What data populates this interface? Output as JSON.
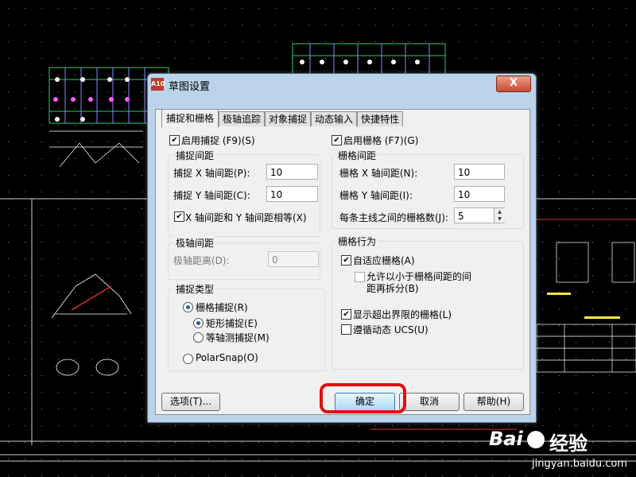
{
  "dialog": {
    "title": "草图设置",
    "app_icon": "A10",
    "close_label": "X",
    "tabs": [
      "捕捉和栅格",
      "极轴追踪",
      "对象捕捉",
      "动态输入",
      "快捷特性"
    ],
    "active_tab": 0
  },
  "snap": {
    "enable_label": "启用捕捉 (F9)(S)",
    "enabled": true,
    "spacing_group": "捕捉间距",
    "x_label": "捕捉 X 轴间距(P):",
    "x_value": "10",
    "y_label": "捕捉 Y 轴间距(C):",
    "y_value": "10",
    "equal_label": "X 轴间距和 Y 轴间距相等(X)",
    "equal_checked": true
  },
  "polar": {
    "group": "极轴间距",
    "distance_label": "极轴距离(D):",
    "distance_value": "0"
  },
  "snap_type": {
    "group": "捕捉类型",
    "grid_snap_label": "栅格捕捉(R)",
    "rect_label": "矩形捕捉(E)",
    "iso_label": "等轴测捕捉(M)",
    "polar_label": "PolarSnap(O)"
  },
  "grid": {
    "enable_label": "启用栅格 (F7)(G)",
    "enabled": true,
    "spacing_group": "栅格间距",
    "x_label": "栅格 X 轴间距(N):",
    "x_value": "10",
    "y_label": "栅格 Y 轴间距(I):",
    "y_value": "10",
    "major_label": "每条主线之间的栅格数(J):",
    "major_value": "5"
  },
  "grid_behavior": {
    "group": "栅格行为",
    "adaptive_label": "自适应栅格(A)",
    "adaptive_checked": true,
    "subdivide_label_1": "允许以小于栅格间距的间",
    "subdivide_label_2": "距再拆分(B)",
    "subdivide_checked": false,
    "beyond_label": "显示超出界限的栅格(L)",
    "beyond_checked": true,
    "dynamic_ucs_label": "遵循动态 UCS(U)",
    "dynamic_ucs_checked": false
  },
  "buttons": {
    "options": "选项(T)...",
    "ok": "确定",
    "cancel": "取消",
    "help": "帮助(H)"
  },
  "watermark": {
    "brand_a": "Bai",
    "brand_b": "经验",
    "url": "jingyan.baidu.com"
  },
  "colors": {
    "accent_red": "#e01010",
    "dialog_frame": "#bcd3ec",
    "cad_background": "#000000"
  }
}
